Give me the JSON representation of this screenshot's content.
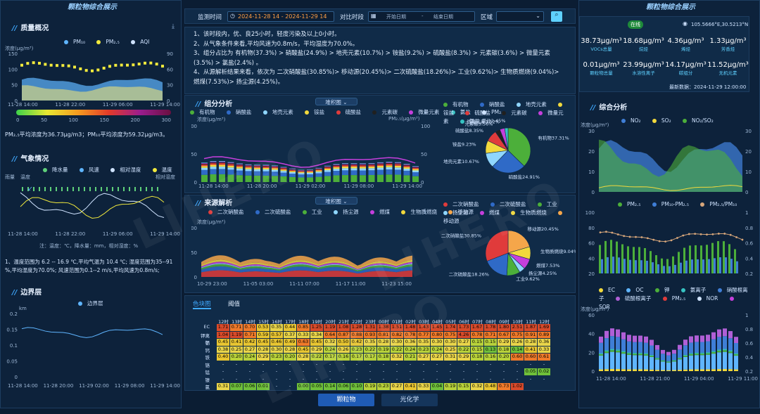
{
  "header": {
    "left_title": "颗粒物综合展示",
    "right_title": "颗粒物综合展示"
  },
  "controls": {
    "monitor_label": "监测时间",
    "monitor_range": "2024-11-28 14 - 2024-11-29 14",
    "compare_label": "对比时段",
    "start_placeholder": "开始日期",
    "dash": "-",
    "end_placeholder": "结束日期",
    "region_label": "区域",
    "region_value": ""
  },
  "summary": {
    "lines": [
      "1、该时段内，优、良25小时，轻度污染及以上0小时。",
      "2、从气象条件来看,平均风速为0.8m/s，平均湿度为70.0%。",
      "3、组分占比为 有机物(37.3%) > 硝酸盐(24.9%) > 地壳元素(10.7%) > 铵盐(9.2%) > 硫酸盐(8.3%) > 元素碳(3.6%) > 微量元素",
      "(3.5%) > 氯盐(2.4%) 。",
      "4、从源解析结果来看，依次为 二次硝酸盐(30.85%)> 移动源(20.45%)> 二次硫酸盐(18.26%)> 工业(9.62%)> 生物质燃烧(9.04%)>",
      "燃煤(7.53%)> 扬尘源(4.25%)。"
    ]
  },
  "quality": {
    "title": "质量概况",
    "unit": "浓度(μg/m³)",
    "legend": [
      "PM₁₀",
      "PM₂.₅",
      "AQI"
    ],
    "y_left": [
      "150",
      "100",
      "50",
      "0"
    ],
    "y_right": [
      "90",
      "60",
      "30",
      "0"
    ],
    "x": [
      "11-28 14:00",
      "11-28 22:00",
      "11-29 06:00",
      "11-29 14:00"
    ],
    "scale": [
      "0",
      "50",
      "100",
      "150",
      "200",
      "300"
    ],
    "note": "PM₂.₅平均浓度为36.73μg/m3；PM₁₀平均浓度为59.32μg/m3。"
  },
  "weather": {
    "title": "气象情况",
    "legend": [
      "降水量",
      "风速",
      "相对湿度",
      "温度"
    ],
    "y_left_label": "雨量",
    "y_left2_label": "温度",
    "y_right_label": "相对湿度",
    "y_left": [
      "0.8",
      "0.6",
      "0.4",
      "0.2",
      "0"
    ],
    "y_left2": [
      "20",
      "15",
      "10",
      "5",
      "0"
    ],
    "y_right": [
      "100",
      "80",
      "60",
      "40",
      "20"
    ],
    "y_right2": [
      "20",
      "15",
      "10",
      "5",
      "0"
    ],
    "x": [
      "11-28 14:00",
      "11-28 22:00",
      "11-29 06:00",
      "11-29 14:00"
    ],
    "note": "注：温度：℃，降水量：mm，相对湿度：%",
    "desc1": "1、温度范围为 6.2 -- 16.9 ℃,平均气温为 10.4 ℃; 湿度范围为35--91",
    "desc2": "%,平均湿度为70.0%; 风速范围为0.1--2 m/s,平均风速为0.8m/s;"
  },
  "boundary": {
    "title": "边界层",
    "legend": "边界层",
    "unit": "km",
    "y": [
      "0.2",
      "0.15",
      "0.1",
      "0.05",
      "0"
    ],
    "x": [
      "11-28 14:00",
      "11-28 20:00",
      "11-29 02:00",
      "11-29 08:00",
      "11-29 14:00"
    ]
  },
  "composition": {
    "title": "组分分析",
    "select": "堆积图",
    "legend": [
      "有机物",
      "硝酸盐",
      "地壳元素",
      "铵盐",
      "硫酸盐",
      "元素碳",
      "微量元素",
      "氯盐",
      "PM₂.₅"
    ],
    "unit": "浓度(μg/m³)",
    "unit_right": "PM₂.₅(μg/m³)",
    "y_left": [
      "100",
      "50",
      "0"
    ],
    "y_right": [
      "100",
      "50",
      "0"
    ],
    "x": [
      "11-28 14:00",
      "11-28 20:00",
      "11-29 02:00",
      "11-29 08:00",
      "11-29 14:00"
    ],
    "pie_legend": [
      "有机物",
      "硝酸盐",
      "地壳元素",
      "铵盐",
      "硫酸盐",
      "元素碳",
      "微量元素",
      "氯盐"
    ],
    "pie_labels": [
      "有机物37.31%",
      "硝酸盐24.91%",
      "地壳元素10.67%",
      "铵盐9.23%",
      "硫酸盐8.35%",
      "元素碳3.56%",
      "微量元素3.52%",
      "氯盐2.45%"
    ]
  },
  "source": {
    "title": "来源解析",
    "select": "堆积图",
    "legend": [
      "二次硝酸盐",
      "二次硫酸盐",
      "工业",
      "扬尘源",
      "燃煤",
      "生物质燃烧",
      "移动源"
    ],
    "unit": "浓度(μg/m³)",
    "y": [
      "100",
      "50",
      "0"
    ],
    "x": [
      "10-29 23:00",
      "11-05 03:00",
      "11-11 07:00",
      "11-17 11:00",
      "11-23 15:00"
    ],
    "pie_legend": [
      "二次硝酸盐",
      "二次硫酸盐",
      "工业",
      "扬尘源",
      "燃煤",
      "生物质燃烧",
      "移动源"
    ],
    "pie_labels": [
      "移动源20.45%",
      "生物质燃烧9.04%",
      "燃煤7.53%",
      "扬尘源4.25%",
      "工业9.62%",
      "二次硫酸盐18.26%",
      "二次硝酸盐30.85%"
    ]
  },
  "heatmap": {
    "tab1": "色块图",
    "tab2": "阈值",
    "hours": [
      "12时",
      "13时",
      "14时",
      "15时",
      "16时",
      "17时",
      "18时",
      "19时",
      "20时",
      "21时",
      "22时",
      "23时",
      "00时",
      "01时",
      "02时",
      "03时",
      "04时",
      "05时",
      "06时",
      "07时",
      "08时",
      "09时",
      "10时",
      "11时",
      "12时"
    ],
    "rows": [
      {
        "label": "EC",
        "vals": [
          "1.71",
          "0.71",
          "0.70",
          "0.53",
          "0.35",
          "0.44",
          "0.85",
          "1.25",
          "1.19",
          "1.08",
          "1.28",
          "1.31",
          "1.38",
          "1.51",
          "1.48",
          "1.43",
          "1.45",
          "1.74",
          "1.73",
          "1.67",
          "1.78",
          "1.80",
          "2.51",
          "1.87",
          "1.69"
        ]
      },
      {
        "label": "钾离子",
        "vals": [
          "1.04",
          "1.19",
          "0.71",
          "0.59",
          "0.57",
          "0.37",
          "0.33",
          "0.34",
          "0.64",
          "0.87",
          "0.88",
          "0.93",
          "0.81",
          "0.82",
          "0.78",
          "0.77",
          "0.80",
          "0.75",
          "4.26",
          "0.78",
          "0.71",
          "0.67",
          "0.75",
          "0.91",
          "0.89"
        ]
      },
      {
        "label": "铝",
        "vals": [
          "0.45",
          "0.41",
          "0.42",
          "0.45",
          "0.46",
          "0.49",
          "0.63",
          "0.45",
          "0.32",
          "0.50",
          "0.42",
          "0.35",
          "0.28",
          "0.30",
          "0.36",
          "0.35",
          "0.30",
          "0.30",
          "0.27",
          "0.15",
          "0.15",
          "0.29",
          "0.26",
          "0.28",
          "0.36"
        ]
      },
      {
        "label": "钙",
        "vals": [
          "0.38",
          "0.25",
          "0.27",
          "0.28",
          "0.30",
          "0.28",
          "0.45",
          "0.29",
          "0.24",
          "0.26",
          "0.23",
          "0.22",
          "0.19",
          "0.22",
          "0.24",
          "0.23",
          "0.24",
          "0.25",
          "0.22",
          "0.15",
          "0.13",
          "0.18",
          "0.14",
          "0.41",
          "0.33"
        ]
      },
      {
        "label": "铁",
        "vals": [
          "0.40",
          "0.20",
          "0.24",
          "0.29",
          "0.23",
          "0.20",
          "0.28",
          "0.22",
          "0.17",
          "0.16",
          "0.17",
          "0.17",
          "0.18",
          "0.32",
          "0.21",
          "0.27",
          "0.27",
          "0.31",
          "0.29",
          "0.18",
          "0.16",
          "0.20",
          "0.60",
          "0.60",
          "0.61"
        ]
      },
      {
        "label": "铬",
        "vals": [
          "-",
          "-",
          "-",
          "-",
          "-",
          "-",
          "-",
          "-",
          "-",
          "-",
          "-",
          "-",
          "-",
          "-",
          "-",
          "-",
          "-",
          "-",
          "-",
          "-",
          "-",
          "-",
          "-",
          "-",
          "-"
        ]
      },
      {
        "label": "锰",
        "vals": [
          "-",
          "-",
          "-",
          "-",
          "-",
          "-",
          "-",
          "-",
          "-",
          "-",
          "-",
          "-",
          "-",
          "-",
          "-",
          "-",
          "-",
          "-",
          "-",
          "-",
          "-",
          "-",
          "-",
          "0.05",
          "0.02"
        ]
      },
      {
        "label": "镍",
        "vals": [
          "-",
          "-",
          "-",
          "-",
          "-",
          "-",
          "-",
          "-",
          "-",
          "-",
          "-",
          "-",
          "-",
          "-",
          "-",
          "-",
          "-",
          "-",
          "-",
          "-",
          "-",
          "-",
          "-",
          "-",
          "-"
        ]
      },
      {
        "label": "氯",
        "vals": [
          "0.31",
          "0.07",
          "0.06",
          "0.01",
          "-",
          "-",
          "0.00",
          "0.05",
          "0.14",
          "0.06",
          "0.10",
          "0.19",
          "0.23",
          "0.27",
          "0.41",
          "0.33",
          "0.04",
          "0.19",
          "0.15",
          "0.32",
          "0.48",
          "0.73",
          "1.02",
          "",
          ""
        ]
      }
    ]
  },
  "bottom_tabs": [
    "颗粒物",
    "光化学"
  ],
  "station": {
    "name": "",
    "status": "在线",
    "coords": "105.5666°E,30.5213°N",
    "update": "最新数据：2024-11-29 12:00:00",
    "metrics": [
      {
        "v": "38.73μg/m³",
        "l": "VOCs总量"
      },
      {
        "v": "18.68μg/m³",
        "l": "烷烃"
      },
      {
        "v": "4.36μg/m³",
        "l": "烯烃"
      },
      {
        "v": "1.33μg/m³",
        "l": "芳香烃"
      },
      {
        "v": "0.01μg/m³",
        "l": "颗粒物总量"
      },
      {
        "v": "23.99μg/m³",
        "l": "水溶性离子"
      },
      {
        "v": "14.17μg/m³",
        "l": "碳组分"
      },
      {
        "v": "11.52μg/m³",
        "l": "无机元素"
      }
    ]
  },
  "integrated": {
    "title": "综合分析",
    "unit": "浓度(μg/m³)",
    "legend1": [
      "NO₂",
      "SO₂",
      "NO₂/SO₂"
    ],
    "y1": [
      "30",
      "20",
      "10",
      "0"
    ],
    "y1r": [
      "30",
      "20",
      "10",
      "0"
    ],
    "legend2": [
      "PM₂.₅",
      "PM₁₀-PM₂.₅",
      "PM₂.₅/PM₁₀"
    ],
    "y2": [
      "100",
      "80",
      "60",
      "40",
      "20"
    ],
    "y2r": [
      "1",
      "0.8",
      "0.6",
      "0.4",
      "0.2"
    ],
    "legend3": [
      "EC",
      "OC",
      "钾",
      "氯离子",
      "硝酸根离子",
      "硫酸根离子",
      "PM₂.₅",
      "NOR",
      "SOR"
    ],
    "unit3": "浓度(μg/m³)",
    "y3": [
      "60",
      "40",
      "20",
      "0"
    ],
    "y3r": [
      "1",
      "0.8",
      "0.6",
      "0.4",
      "0.2"
    ],
    "x3": [
      "11-28 14:00",
      "11-28 21:00",
      "11-29 04:00",
      "11-29 11:00"
    ]
  },
  "watermark": "LIHERO",
  "chart_colors": {
    "accent": "#3fa9ff",
    "bg": "#0f2640"
  }
}
